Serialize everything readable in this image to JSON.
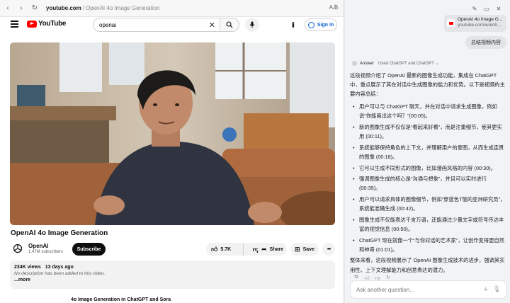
{
  "browser": {
    "url_domain": "youtube.com",
    "url_separator": "/",
    "url_title": "OpenAI 4o Image Generation",
    "reader_label": "Aあ"
  },
  "youtube": {
    "logo_text": "YouTube",
    "search_value": "openai",
    "sign_in_label": "Sign in",
    "video_title": "OpenAI 4o Image Generation",
    "channel_name": "OpenAI",
    "subscribers": "1.47M subscribers",
    "subscribe_label": "Subscribe",
    "like_count": "5.7K",
    "share_label": "Share",
    "save_label": "Save",
    "views": "234K views",
    "age": "13 days ago",
    "description": "No description has been added to this video.",
    "more_label": "...more",
    "next_video_title": "4o Image Generation in ChatGPT and Sora"
  },
  "panel": {
    "tab_card_title": "OpenAI 4o Image G...",
    "tab_card_url": "youtube.com/watch...",
    "user_message": "总结视频内容",
    "answer_label": "Answer",
    "answer_source": "Used ChatGPT and ChatGPT ⌄",
    "intro": "这段视频介绍了 OpenAI 最新的图像生成功能，集成在 ChatGPT 中，重点展示了其在对话中生成图像的能力和优势。以下是视频的主要内容总结：",
    "bullets": [
      "用户可以与 ChatGPT 聊天，并在对话中请求生成图像，例如说“你能画出这个吗？”(00:05)。",
      "新的图像生成不仅仅是“看起来好看”，而是注重细节，使其更实用 (00:11)。",
      "系统能够保持角色的上下文，并理解用户的意图，从而生成连贯的图像 (00:18)。",
      "它可以生成不同形式的图像，比如漫画风格的内容 (00:30)。",
      "强调图像生成的核心是“沟通与想象”，并且可以实时进行 (00:35)。",
      "用户可以请求具体的图像细节，例如“穿蓝色T恤的亚洲研究员”，系统能准确生成 (00:42)。",
      "图像生成不仅能表达千言万语，还能通过少量文字或符号传达丰富的视觉信息 (00:50)。",
      "ChatGPT 现在就像一个“与你对话的艺术家”，让创作变得更自然和神奇 (01:01)。"
    ],
    "conclusion": "整体来看，这段视频展示了 OpenAI 图像生成技术的进步，强调其实用性、上下文理解能力和创意表达的潜力。",
    "ask_placeholder": "Ask another question..."
  },
  "colors": {
    "youtube_red": "#ff0000",
    "link_blue": "#065fd4",
    "panel_bg": "#f2f3f5"
  }
}
